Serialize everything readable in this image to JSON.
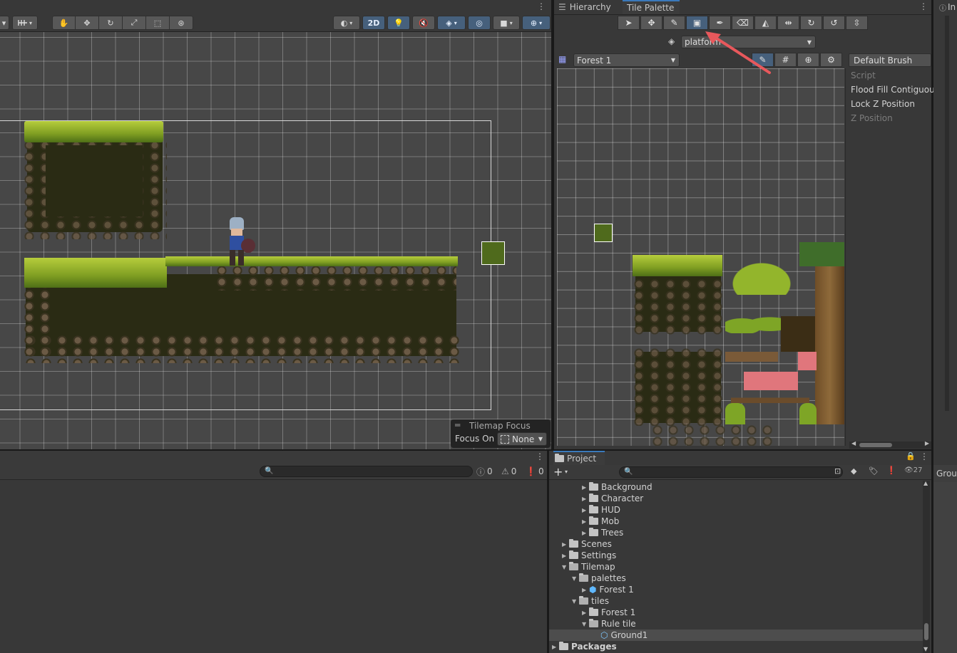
{
  "scene": {
    "tilemap_focus": {
      "title": "Tilemap Focus",
      "label": "Focus On",
      "value": "None"
    },
    "toolbar": {
      "two_d_label": "2D"
    }
  },
  "tile_palette": {
    "tabs": [
      {
        "label": "Hierarchy"
      },
      {
        "label": "Tile Palette"
      }
    ],
    "active_tilemap": "platform",
    "palette": "Forest 1",
    "brush": "Default Brush",
    "brush_props": {
      "script": "Script",
      "flood_fill": "Flood Fill Contiguous",
      "lock_z": "Lock Z Position",
      "z_position": "Z Position"
    }
  },
  "console": {
    "counts": {
      "info": "0",
      "warn": "0",
      "error": "0"
    }
  },
  "project": {
    "title": "Project",
    "hidden_count": "27",
    "tree": [
      {
        "label": "Background"
      },
      {
        "label": "Character"
      },
      {
        "label": "HUD"
      },
      {
        "label": "Mob"
      },
      {
        "label": "Trees"
      },
      {
        "label": "Scenes"
      },
      {
        "label": "Settings"
      },
      {
        "label": "Tilemap"
      },
      {
        "label": "palettes"
      },
      {
        "label": "Forest 1"
      },
      {
        "label": "tiles"
      },
      {
        "label": "Forest 1"
      },
      {
        "label": "Rule tile"
      },
      {
        "label": "Ground1"
      },
      {
        "label": "Packages"
      }
    ]
  },
  "inspector": {
    "tab_label": "In",
    "item": "Grou"
  },
  "colors": {
    "accent": "#46607c",
    "selection": "#4d4d4d",
    "arrow": "#e8585c"
  }
}
